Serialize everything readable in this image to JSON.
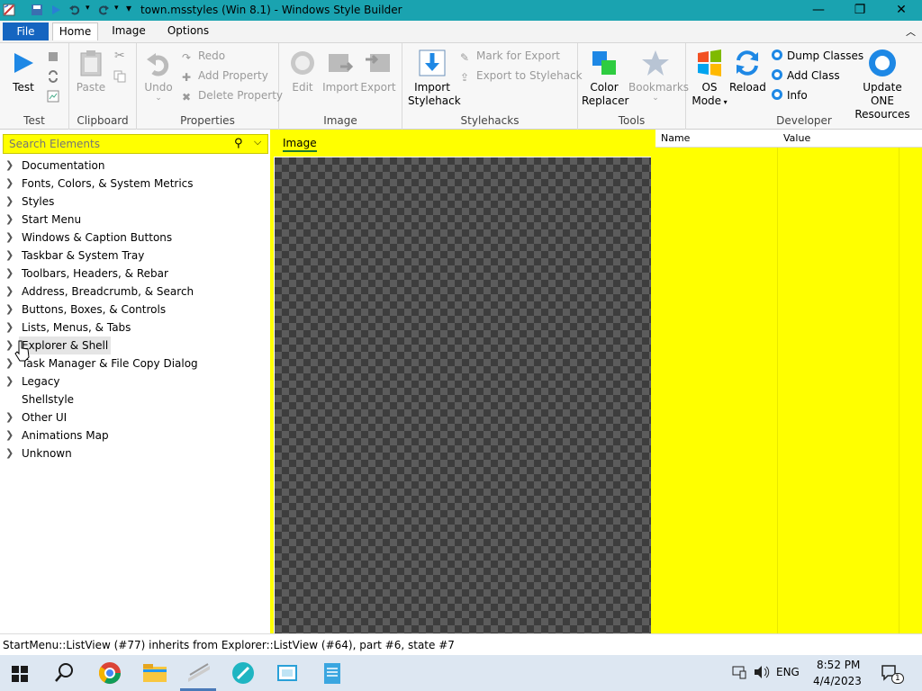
{
  "window": {
    "title": "town.msstyles (Win 8.1) - Windows Style Builder",
    "minimize_glyph": "—",
    "maximize_glyph": "❐",
    "close_glyph": "✕"
  },
  "menu_tabs": {
    "file": "File",
    "home": "Home",
    "image": "Image",
    "options": "Options"
  },
  "ribbon": {
    "test": {
      "label": "Test",
      "group": "Test"
    },
    "clipboard": {
      "paste": "Paste",
      "group": "Clipboard"
    },
    "properties": {
      "undo": "Undo",
      "redo": "Redo",
      "add_property": "Add Property",
      "delete_property": "Delete Property",
      "group": "Properties"
    },
    "image": {
      "edit": "Edit",
      "import": "Import",
      "export": "Export",
      "group": "Image"
    },
    "stylehacks": {
      "import_line1": "Import",
      "import_line2": "Stylehack",
      "mark_for_export": "Mark for Export",
      "export_to_stylehack": "Export to Stylehack",
      "group": "Stylehacks"
    },
    "tools": {
      "color_line1": "Color",
      "color_line2": "Replacer",
      "bookmarks": "Bookmarks",
      "group": "Tools"
    },
    "developer": {
      "os_line1": "OS",
      "os_line2": "Mode",
      "reload": "Reload",
      "dump_classes": "Dump Classes",
      "add_class": "Add Class",
      "info": "Info",
      "update_line1": "Update ONE",
      "update_line2": "Resources",
      "group": "Developer"
    }
  },
  "search": {
    "placeholder": "Search Elements"
  },
  "tree": {
    "items": [
      {
        "label": "Documentation",
        "expandable": true
      },
      {
        "label": "Fonts, Colors, & System Metrics",
        "expandable": true
      },
      {
        "label": "Styles",
        "expandable": true
      },
      {
        "label": "Start Menu",
        "expandable": true
      },
      {
        "label": "Windows & Caption Buttons",
        "expandable": true
      },
      {
        "label": "Taskbar & System Tray",
        "expandable": true
      },
      {
        "label": "Toolbars, Headers, & Rebar",
        "expandable": true
      },
      {
        "label": "Address, Breadcrumb, & Search",
        "expandable": true
      },
      {
        "label": "Buttons, Boxes, & Controls",
        "expandable": true
      },
      {
        "label": "Lists, Menus, & Tabs",
        "expandable": true
      },
      {
        "label": "Explorer & Shell",
        "expandable": true
      },
      {
        "label": "Task Manager & File Copy Dialog",
        "expandable": true
      },
      {
        "label": "Legacy",
        "expandable": true
      },
      {
        "label": "Shellstyle",
        "expandable": false
      },
      {
        "label": "Other UI",
        "expandable": true
      },
      {
        "label": "Animations Map",
        "expandable": true
      },
      {
        "label": "Unknown",
        "expandable": true
      }
    ]
  },
  "image_panel": {
    "tab": "Image"
  },
  "properties_panel": {
    "name_header": "Name",
    "value_header": "Value"
  },
  "status": {
    "text": "StartMenu::ListView (#77) inherits from Explorer::ListView (#64), part #6, state #7"
  },
  "taskbar": {
    "tray": {
      "language": "ENG",
      "time": "8:52 PM",
      "date": "4/4/2023",
      "notification_count": "1"
    }
  },
  "colors": {
    "highlight": "#ffff00",
    "titlebar": "#1aa3b0",
    "file_tab": "#1565c0",
    "taskbar": "#dde7f2"
  }
}
